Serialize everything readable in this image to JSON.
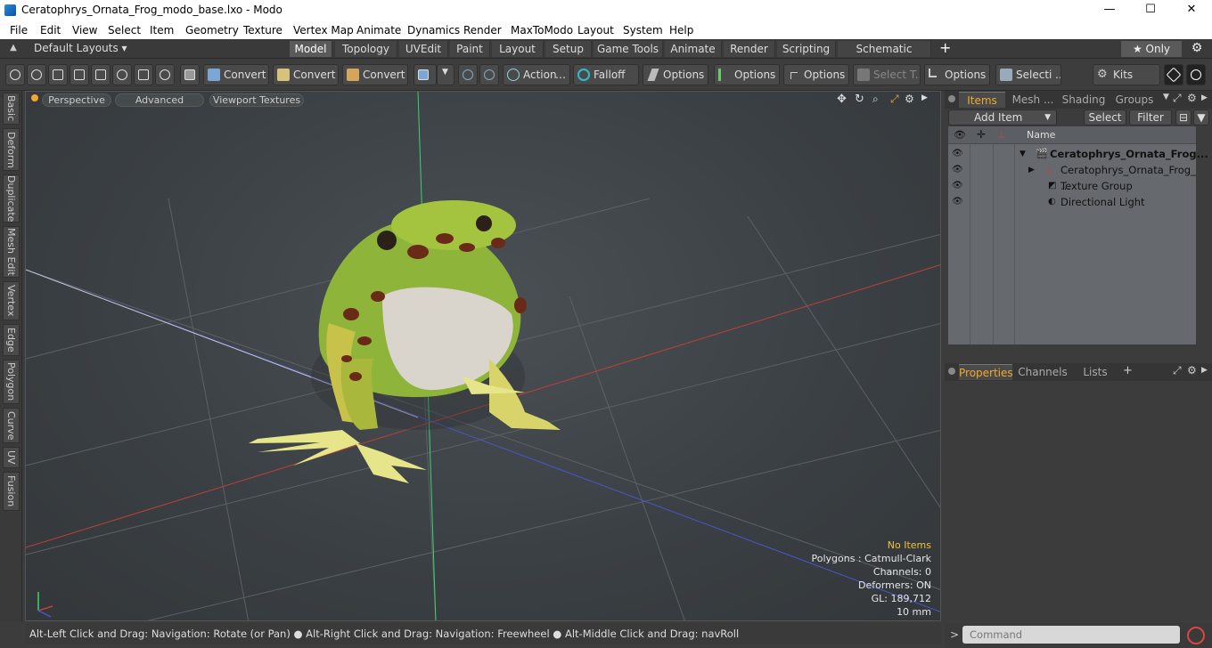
{
  "window": {
    "title": "Ceratophrys_Ornata_Frog_modo_base.lxo - Modo",
    "minimize": "—",
    "maximize": "☐",
    "close": "✕"
  },
  "menu": [
    "File",
    "Edit",
    "View",
    "Select",
    "Item",
    "Geometry",
    "Texture",
    "Vertex Map",
    "Animate",
    "Dynamics",
    "Render",
    "MaxToModo",
    "Layout",
    "System",
    "Help"
  ],
  "layouts": {
    "preset": "Default Layouts ▾",
    "tabs": [
      "Model",
      "Topology",
      "UVEdit",
      "Paint",
      "Layout",
      "Setup",
      "Game Tools",
      "Animate",
      "Render",
      "Scripting",
      "Schematic Fusion"
    ],
    "active_tab": "Model",
    "add": "+",
    "only": "★  Only"
  },
  "toolbar": {
    "convert1": "Convert",
    "convert2": "Convert",
    "convert3": "Convert",
    "action": "Action",
    "falloff": "Falloff",
    "options1": "Options",
    "options2": "Options",
    "options3": "Options",
    "select_t": "Select T...",
    "options4": "Options",
    "selecti": "Selecti ...",
    "kits": "Kits"
  },
  "left_tabs": [
    "Basic",
    "Deform",
    "Duplicate",
    "Mesh Edit",
    "Vertex",
    "Edge",
    "Polygon",
    "Curve",
    "UV",
    "Fusion"
  ],
  "viewport": {
    "perspective": "Perspective",
    "advanced": "Advanced",
    "textures": "Viewport Textures",
    "info": {
      "no_items": "No Items",
      "polygons": "Polygons : Catmull-Clark",
      "channels": "Channels: 0",
      "deformers": "Deformers: ON",
      "gl": "GL: 189,712",
      "unit": "10 mm"
    }
  },
  "status": "Alt-Left Click and Drag: Navigation: Rotate (or Pan) ● Alt-Right Click and Drag: Navigation: Freewheel ● Alt-Middle Click and Drag: navRoll",
  "items_panel": {
    "tabs": [
      "Items",
      "Mesh ...",
      "Shading",
      "Groups"
    ],
    "add_item": "Add Item",
    "select": "Select",
    "filter": "Filter",
    "name_header": "Name",
    "rows": [
      "Ceratophrys_Ornata_Frog...",
      "Ceratophrys_Ornata_Frog_ ...",
      "Texture Group",
      "Directional Light"
    ]
  },
  "properties_panel": {
    "tabs": [
      "Properties",
      "Channels",
      "Lists"
    ],
    "add": "+"
  },
  "command": {
    "placeholder": "Command",
    "prompt": ">"
  }
}
